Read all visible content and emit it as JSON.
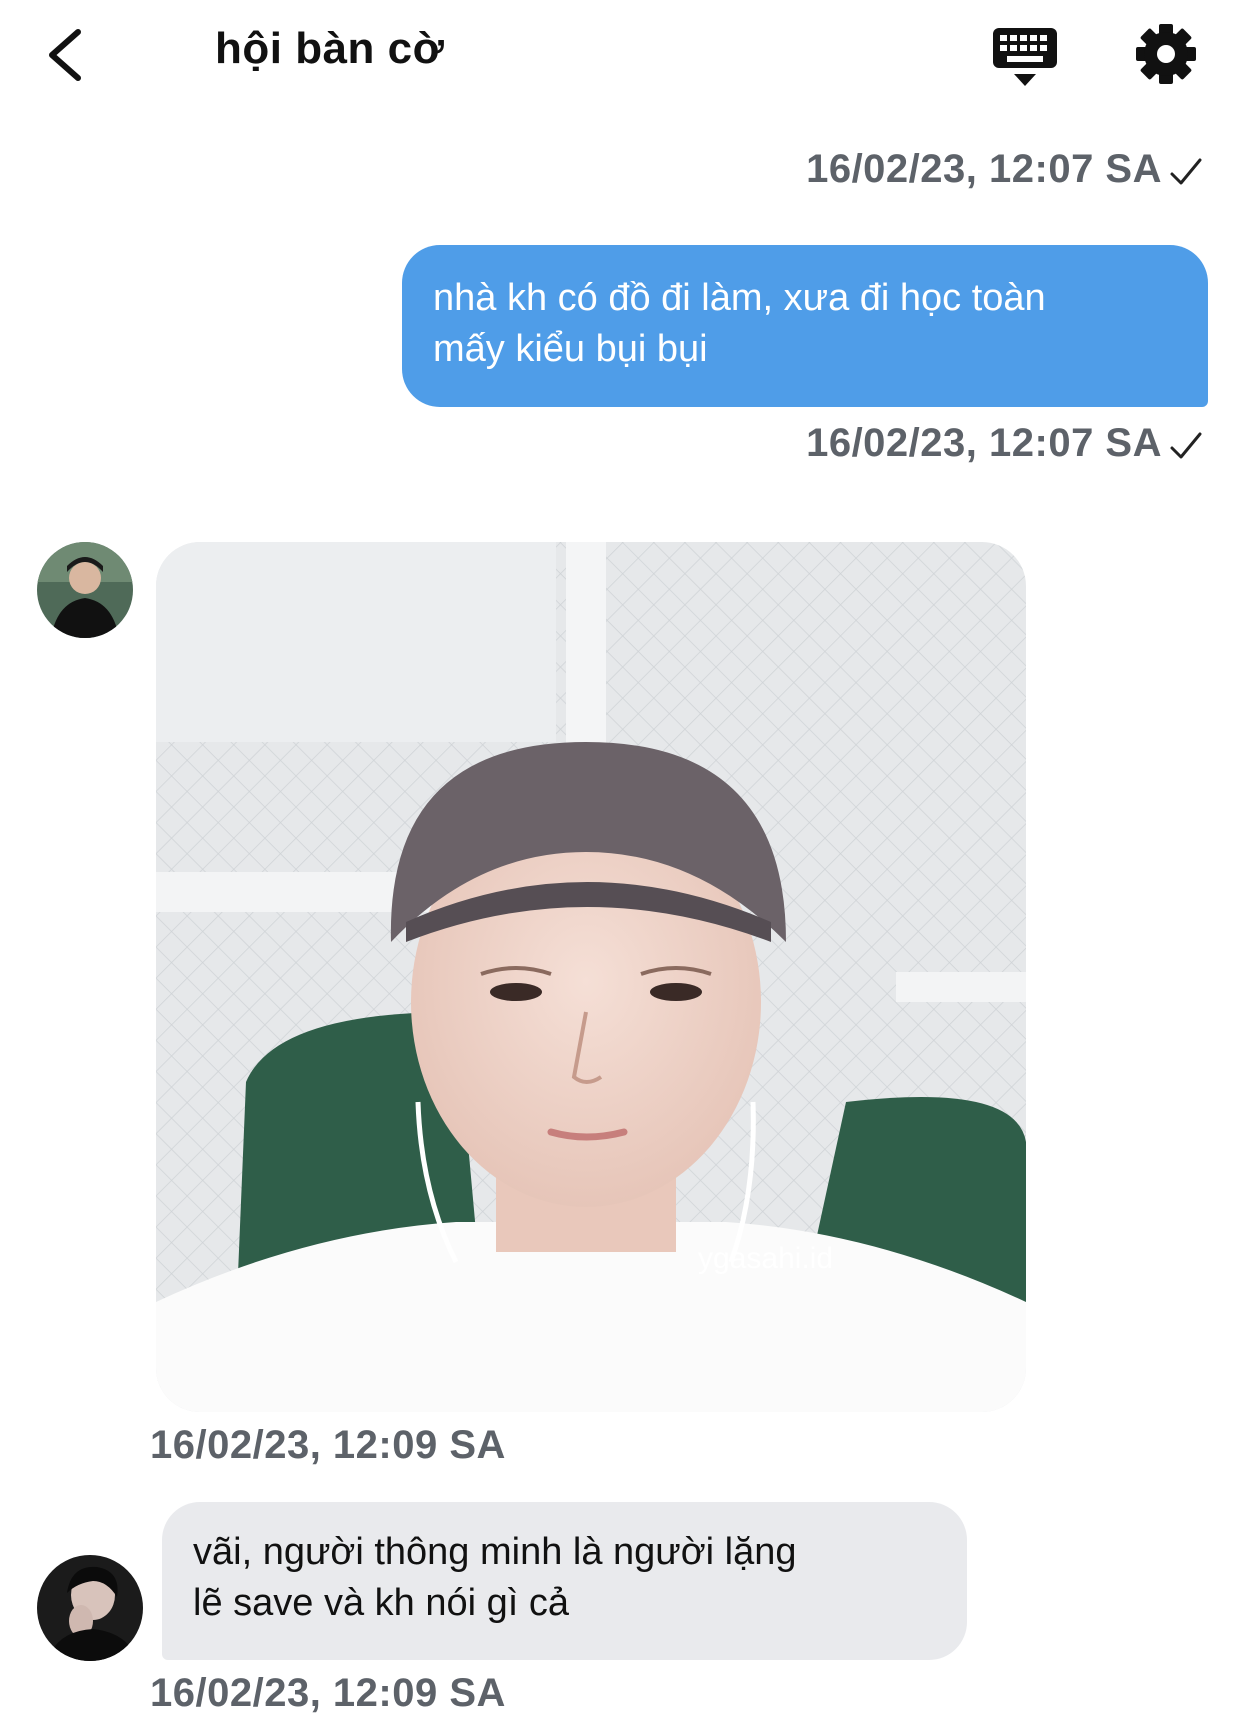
{
  "header": {
    "title": "hội bàn cờ"
  },
  "messages": [
    {
      "type": "timestamp",
      "text": "16/02/23, 12:07 SA"
    },
    {
      "type": "outgoing",
      "text_line1": "nhà kh có đồ đi làm, xưa đi học toàn",
      "text_line2": "mấy kiểu bụi bụi"
    },
    {
      "type": "timestamp",
      "text": "16/02/23, 12:07 SA"
    },
    {
      "type": "incoming-image",
      "watermark": "ygasahi.id"
    },
    {
      "type": "timestamp",
      "text": "16/02/23, 12:09 SA"
    },
    {
      "type": "incoming",
      "text_line1": "vãi, người thông minh là người lặng",
      "text_line2": "lẽ save và kh nói gì cả"
    },
    {
      "type": "timestamp",
      "text": "16/02/23, 12:09 SA"
    }
  ],
  "icons": {
    "back": "chevron-left-icon",
    "keyboard": "keyboard-icon",
    "settings": "gear-icon",
    "read": "checkmark-icon"
  },
  "colors": {
    "outgoing_bubble": "#4f9de8",
    "incoming_bubble": "#e9eaed",
    "timestamp": "#5d6269"
  }
}
